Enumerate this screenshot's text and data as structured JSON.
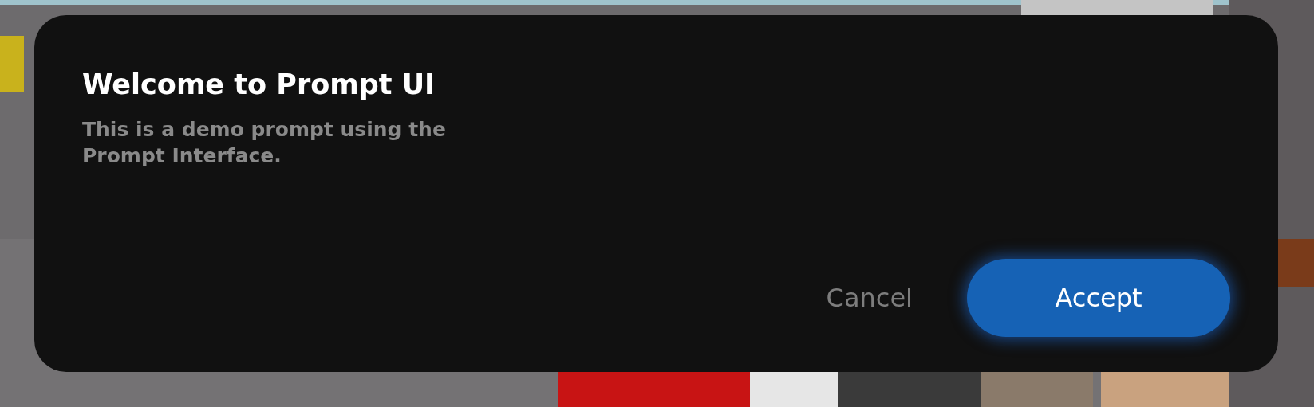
{
  "prompt": {
    "title": "Welcome to Prompt UI",
    "description": "This is a demo prompt using the Prompt Interface.",
    "buttons": [
      {
        "label": "Cancel",
        "kind": "secondary"
      },
      {
        "label": "Accept",
        "kind": "primary"
      }
    ]
  }
}
